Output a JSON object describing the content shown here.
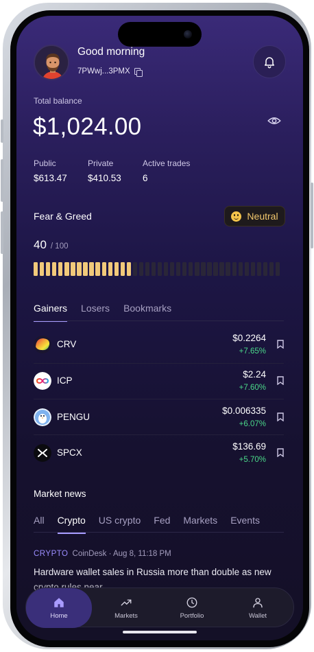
{
  "header": {
    "greeting": "Good morning",
    "address": "7PWwj...3PMX"
  },
  "balance": {
    "label": "Total balance",
    "value": "$1,024.00"
  },
  "stats": [
    {
      "label": "Public",
      "value": "$613.47"
    },
    {
      "label": "Private",
      "value": "$410.53"
    },
    {
      "label": "Active trades",
      "value": "6"
    }
  ],
  "fear_greed": {
    "title": "Fear & Greed",
    "badge": "Neutral",
    "score": "40",
    "max": "/ 100",
    "level": 0.4,
    "accent": "#f1c97a"
  },
  "tabs": [
    "Gainers",
    "Losers",
    "Bookmarks"
  ],
  "tokens": [
    {
      "symbol": "CRV",
      "price": "$0.2264",
      "change": "+7.65%",
      "icon": "crv-logo-icon"
    },
    {
      "symbol": "ICP",
      "price": "$2.24",
      "change": "+7.60%",
      "icon": "icp-logo-icon"
    },
    {
      "symbol": "PENGU",
      "price": "$0.006335",
      "change": "+6.07%",
      "icon": "pengu-logo-icon"
    },
    {
      "symbol": "SPCX",
      "price": "$136.69",
      "change": "+5.70%",
      "icon": "spcx-logo-icon"
    }
  ],
  "news": {
    "title": "Market news",
    "tabs": [
      "All",
      "Crypto",
      "US crypto",
      "Fed",
      "Markets",
      "Events"
    ],
    "article": {
      "tag": "CRYPTO",
      "meta": "CoinDesk · Aug 8, 11:18 PM",
      "headline": "Hardware wallet sales in Russia more than double as new crypto rules near"
    }
  },
  "nav": [
    "Home",
    "Markets",
    "Portfolio",
    "Wallet"
  ],
  "colors": {
    "positive": "#4bd98a",
    "accent": "#a89cff"
  }
}
